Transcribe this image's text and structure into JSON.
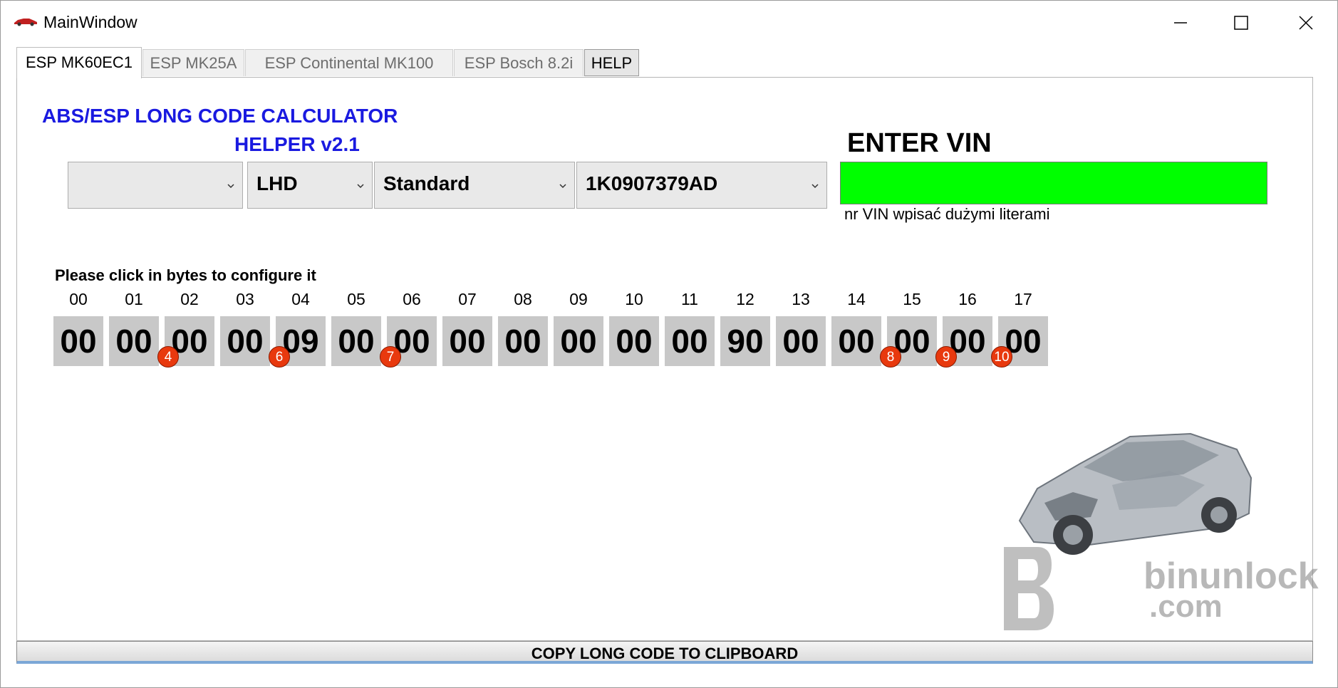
{
  "window": {
    "title": "MainWindow"
  },
  "tabs": [
    {
      "label": "ESP MK60EC1",
      "active": true
    },
    {
      "label": "ESP MK25A",
      "active": false
    },
    {
      "label": "ESP Continental MK100",
      "active": false
    },
    {
      "label": "ESP Bosch 8.2i",
      "active": false
    },
    {
      "label": "HELP",
      "active": false
    }
  ],
  "header": {
    "title": "ABS/ESP LONG CODE CALCULATOR",
    "subtitle": "HELPER v2.1"
  },
  "dropdowns": [
    {
      "value": ""
    },
    {
      "value": "LHD"
    },
    {
      "value": "Standard"
    },
    {
      "value": "1K0907379AD"
    }
  ],
  "vin": {
    "label": "ENTER VIN",
    "value": "",
    "hint": "nr VIN wpisać dużymi literami",
    "bg_color": "#00ff00"
  },
  "bytes": {
    "hint": "Please click in bytes to configure it",
    "indices": [
      "00",
      "01",
      "02",
      "03",
      "04",
      "05",
      "06",
      "07",
      "08",
      "09",
      "10",
      "11",
      "12",
      "13",
      "14",
      "15",
      "16",
      "17"
    ],
    "values": [
      "00",
      "00",
      "00",
      "00",
      "09",
      "00",
      "00",
      "00",
      "00",
      "00",
      "00",
      "00",
      "90",
      "00",
      "00",
      "00",
      "00",
      "00"
    ],
    "markers": [
      {
        "byte": 2,
        "label": "4"
      },
      {
        "byte": 4,
        "label": "6"
      },
      {
        "byte": 6,
        "label": "7"
      },
      {
        "byte": 15,
        "label": "8"
      },
      {
        "byte": 16,
        "label": "9"
      },
      {
        "byte": 17,
        "label": "10"
      }
    ],
    "marker_color": "#e8390e"
  },
  "watermark": {
    "text": "binunlock",
    "suffix": ".com"
  },
  "footer": {
    "copy_label": "COPY LONG CODE TO CLIPBOARD"
  },
  "colors": {
    "title_blue": "#1a1ae0",
    "byte_bg": "#c8c8c8"
  }
}
